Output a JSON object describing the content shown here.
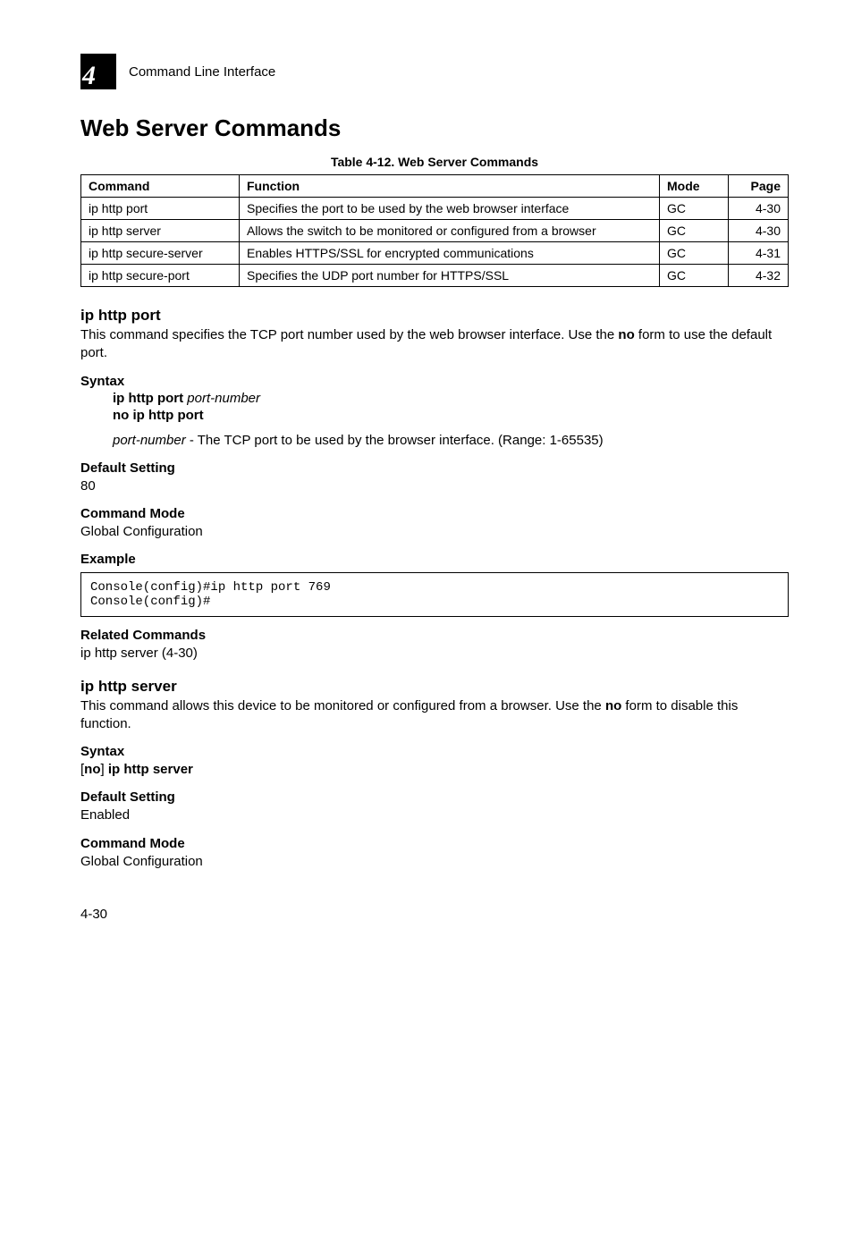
{
  "header": {
    "chapter_number": "4",
    "title": "Command Line Interface"
  },
  "section_title": "Web Server Commands",
  "table": {
    "caption": "Table 4-12.  Web Server Commands",
    "headers": {
      "cmd": "Command",
      "func": "Function",
      "mode": "Mode",
      "page": "Page"
    },
    "rows": [
      {
        "cmd": "ip http port",
        "func": "Specifies the port to be used by the web browser interface",
        "mode": "GC",
        "page": "4-30"
      },
      {
        "cmd": "ip http server",
        "func": "Allows the switch to be monitored or configured from a browser",
        "mode": "GC",
        "page": "4-30"
      },
      {
        "cmd": "ip http secure-server",
        "func": "Enables HTTPS/SSL for encrypted communications",
        "mode": "GC",
        "page": "4-31"
      },
      {
        "cmd": "ip http secure-port",
        "func": "Specifies the UDP port number for HTTPS/SSL",
        "mode": "GC",
        "page": "4-32"
      }
    ]
  },
  "cmd1": {
    "heading": "ip http port",
    "desc_part1": "This command specifies the TCP port number used by the web browser interface. Use the ",
    "desc_bold": "no",
    "desc_part2": " form to use the default port.",
    "syntax_label": "Syntax",
    "syntax_line1_bold": "ip http port",
    "syntax_line1_italic": " port-number",
    "syntax_line2": "no ip http port",
    "param_italic": "port-number",
    "param_rest": " - The TCP port to be used by the browser interface. (Range: 1-65535)",
    "default_label": "Default Setting",
    "default_value": "80",
    "mode_label": "Command Mode",
    "mode_value": "Global Configuration",
    "example_label": "Example",
    "example_code": "Console(config)#ip http port 769\nConsole(config)#",
    "related_label": "Related Commands",
    "related_value": "ip http server (4-30)"
  },
  "cmd2": {
    "heading": "ip http server",
    "desc_part1": "This command allows this device to be monitored or configured from a browser. Use the ",
    "desc_bold": "no",
    "desc_part2": " form to disable this function.",
    "syntax_label": "Syntax",
    "syntax_open": "[",
    "syntax_no": "no",
    "syntax_close": "] ",
    "syntax_cmd": "ip http server",
    "default_label": "Default Setting",
    "default_value": "Enabled",
    "mode_label": "Command Mode",
    "mode_value": "Global Configuration"
  },
  "footer_page": "4-30"
}
